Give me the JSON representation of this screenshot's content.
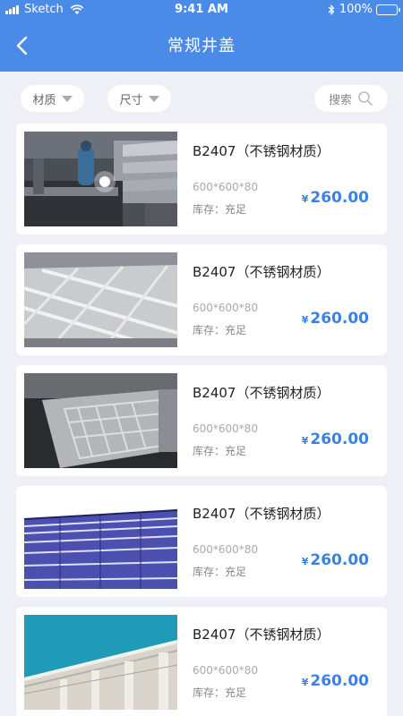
{
  "status_bar": {
    "carrier": "Sketch",
    "time": "9:41 AM",
    "battery": "100%"
  },
  "header": {
    "title": "常规井盖"
  },
  "filters": {
    "material_label": "材质",
    "size_label": "尺寸",
    "search_label": "搜索"
  },
  "products": [
    {
      "name": "B2407（不锈钢材质）",
      "spec": "600*600*80",
      "stock": "库存：充足",
      "currency": "¥",
      "price": "260.00",
      "image": "welding-workshop-photo"
    },
    {
      "name": "B2407（不锈钢材质）",
      "spec": "600*600*80",
      "stock": "库存：充足",
      "currency": "¥",
      "price": "260.00",
      "image": "steel-grate-photo"
    },
    {
      "name": "B2407（不锈钢材质）",
      "spec": "600*600*80",
      "stock": "库存：充足",
      "currency": "¥",
      "price": "260.00",
      "image": "steel-cover-photo"
    },
    {
      "name": "B2407（不锈钢材质）",
      "spec": "600*600*80",
      "stock": "库存：充足",
      "currency": "¥",
      "price": "260.00",
      "image": "glass-facade-photo"
    },
    {
      "name": "B2407（不锈钢材质）",
      "spec": "600*600*80",
      "stock": "库存：充足",
      "currency": "¥",
      "price": "260.00",
      "image": "classical-building-photo"
    }
  ],
  "colors": {
    "primary": "#4a8be8",
    "price": "#3b82e0",
    "background": "#eef0f5"
  }
}
